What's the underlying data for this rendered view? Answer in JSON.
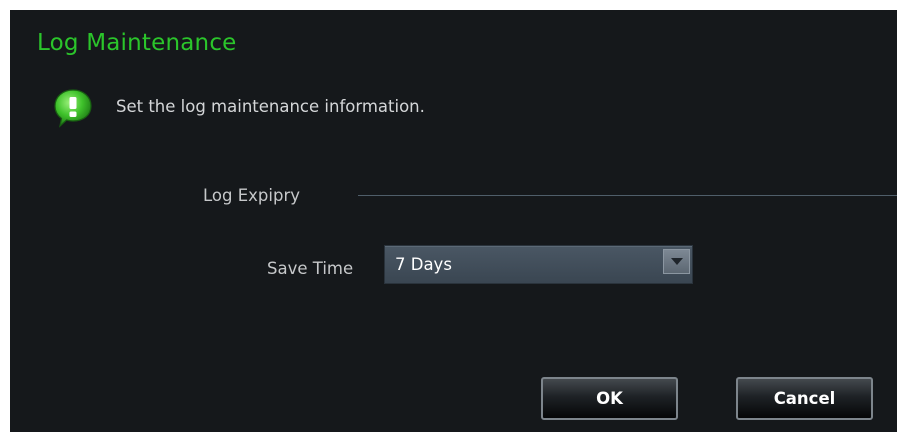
{
  "dialog": {
    "title": "Log Maintenance",
    "info_icon": "info-bubble-icon",
    "info_text": "Set the log maintenance information.",
    "accent_color": "#2bc52b",
    "background_color": "#15181b"
  },
  "log_expiry": {
    "section_label": "Log Expipry",
    "save_time_label": "Save Time",
    "save_time_value": "7 Days"
  },
  "buttons": {
    "ok_label": "OK",
    "cancel_label": "Cancel"
  }
}
